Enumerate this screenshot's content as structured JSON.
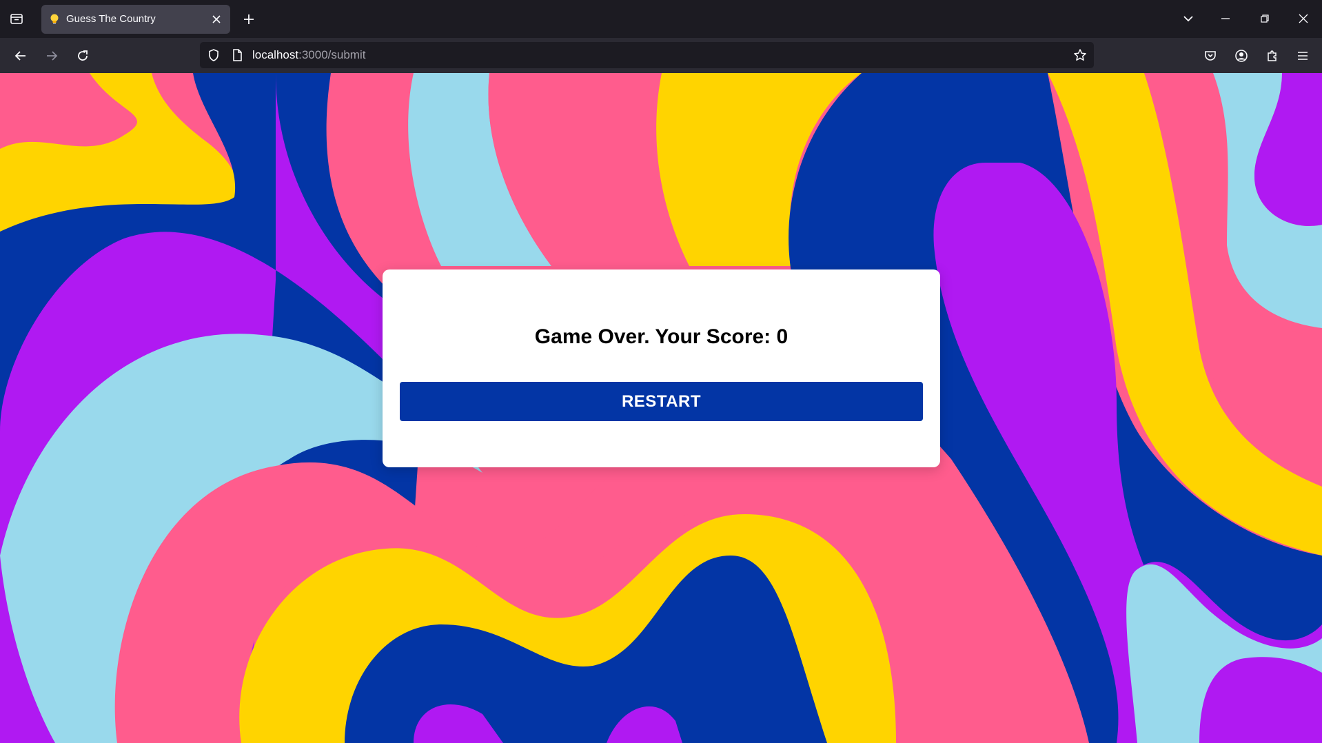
{
  "browser": {
    "tab": {
      "title": "Guess The Country",
      "favicon": "lightbulb-icon"
    },
    "url": {
      "host": "localhost",
      "rest": ":3000/submit"
    },
    "icons": {
      "tab_list": "tab-list-icon",
      "close_tab": "close-icon",
      "new_tab": "plus-icon",
      "list_all_tabs": "chevron-down-icon",
      "minimize": "minimize-icon",
      "restore": "restore-icon",
      "close_window": "close-icon",
      "back": "back-arrow-icon",
      "forward": "forward-arrow-icon",
      "reload": "reload-icon",
      "shield": "shield-icon",
      "page": "page-icon",
      "bookmark": "star-icon",
      "pocket": "pocket-icon",
      "account": "account-icon",
      "extensions": "puzzle-icon",
      "menu": "hamburger-menu-icon"
    }
  },
  "colors": {
    "pink": "#ff5c8d",
    "yellow": "#ffd400",
    "blue": "#0335a5",
    "purple": "#b019f2",
    "light_blue": "#99d9ec",
    "button": "#0335a5"
  },
  "game": {
    "result_text": "Game Over. Your Score: 0",
    "restart_label": "RESTART"
  }
}
